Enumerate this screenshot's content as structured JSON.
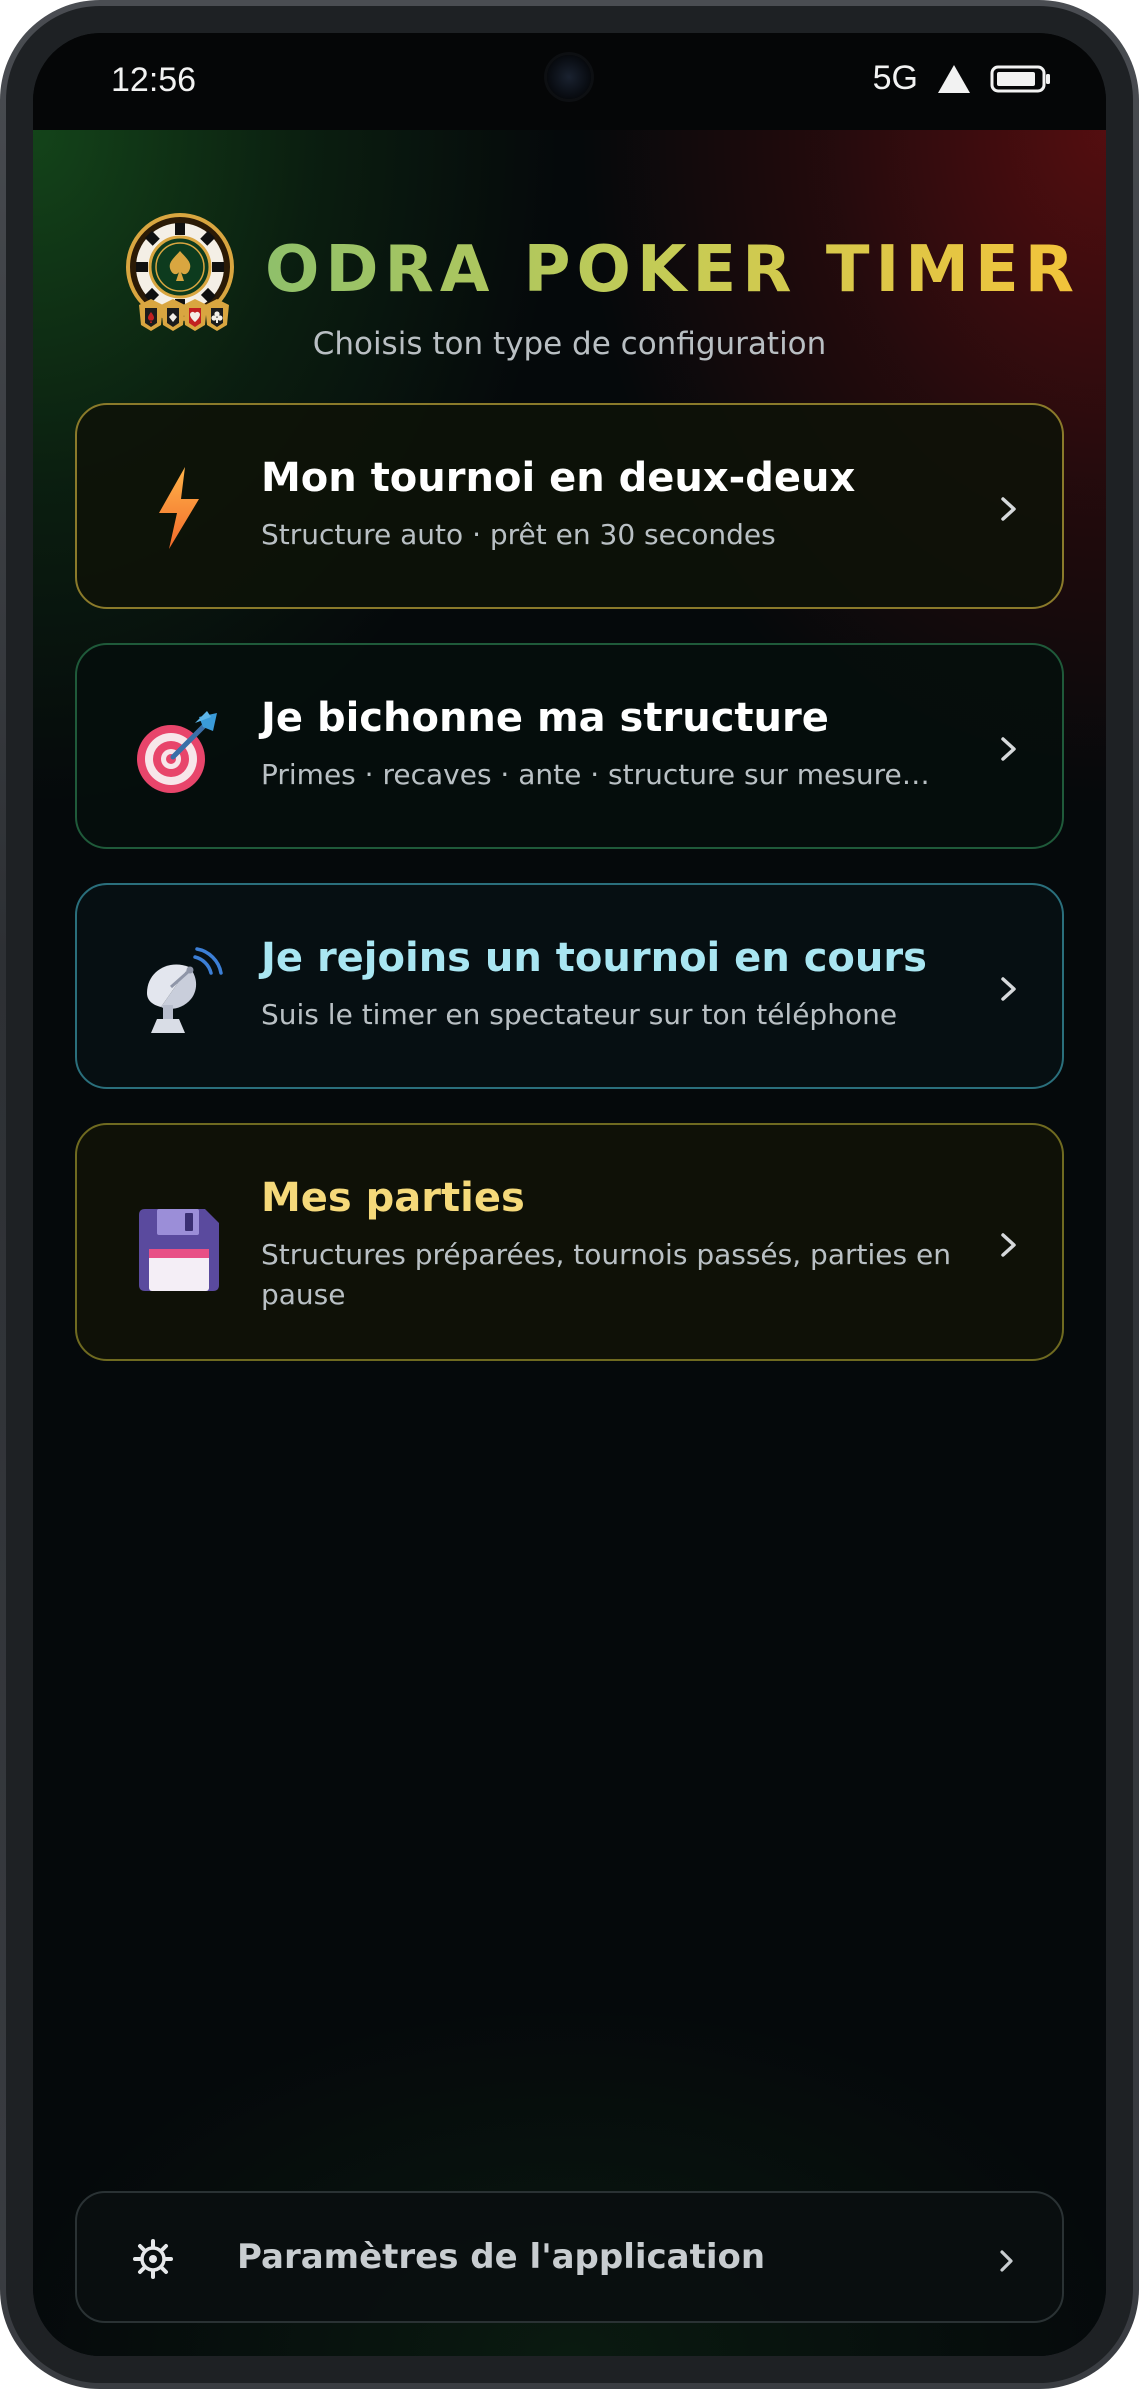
{
  "status_bar": {
    "time": "12:56",
    "network": "5G"
  },
  "header": {
    "app_title": "ODRA POKER TIMER",
    "subtitle": "Choisis ton type de configuration",
    "logo_icon": "poker-chip-logo-icon"
  },
  "options": [
    {
      "icon": "lightning-bolt-icon",
      "title": "Mon tournoi en deux-deux",
      "description": "Structure auto · prêt en 30 secondes",
      "title_color": "#ffffff",
      "border_color": "#8a7a2a"
    },
    {
      "icon": "target-dart-icon",
      "title": "Je bichonne ma structure",
      "description": "Primes · recaves · ante · structure sur mesure…",
      "title_color": "#ffffff",
      "border_color": "#1f5a3a"
    },
    {
      "icon": "satellite-dish-icon",
      "title": "Je rejoins un tournoi en cours",
      "description": "Suis le timer en spectateur sur ton téléphone",
      "title_color": "#a9e6f2",
      "border_color": "#2a6f7c"
    },
    {
      "icon": "floppy-disk-icon",
      "title": "Mes parties",
      "description": "Structures préparées, tournois passés, parties en pause",
      "title_color": "#f5d97a",
      "border_color": "#6f6a20"
    }
  ],
  "settings": {
    "label": "Paramètres de l'application",
    "icon": "gear-icon"
  },
  "colors": {
    "title_gradient_start": "#8fc06a",
    "title_gradient_end": "#f3c33a",
    "background": "#05090b"
  }
}
